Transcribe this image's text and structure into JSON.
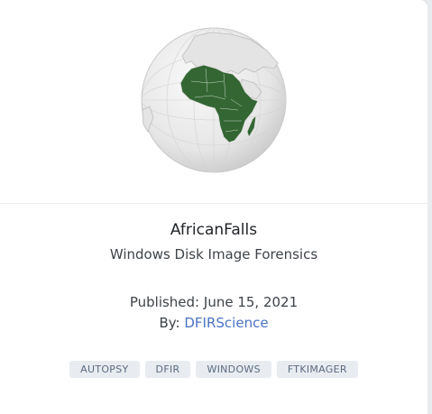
{
  "card": {
    "title": "AfricanFalls",
    "subtitle": "Windows Disk Image Forensics",
    "published_label": "Published:",
    "published_date": "June 15, 2021",
    "by_label": "By:",
    "author": "DFIRScience",
    "tags": [
      "AUTOPSY",
      "DFIR",
      "WINDOWS",
      "FTKIMAGER"
    ],
    "image_icon": "globe-africa-icon",
    "colors": {
      "africa": "#336633",
      "link": "#4a73c6",
      "tag_bg": "#e8ecf1",
      "tag_text": "#5a6a80"
    }
  }
}
